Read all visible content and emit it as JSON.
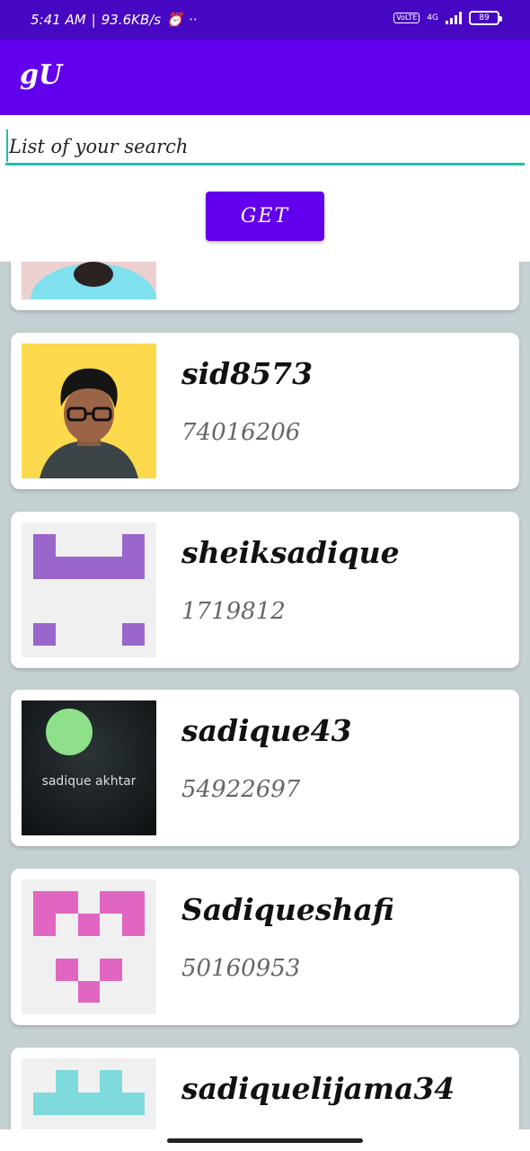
{
  "status_bar": {
    "time": "5:41 AM",
    "separator": "|",
    "speed": "93.6KB/s",
    "volte": "VoLTE",
    "network": "4G",
    "battery": "89"
  },
  "app_bar": {
    "title": "gU"
  },
  "search": {
    "placeholder": "List of your search",
    "value": ""
  },
  "get_button": {
    "label": "GET"
  },
  "results": [
    {
      "name": "",
      "id": ""
    },
    {
      "name": "sid8573",
      "id": "74016206"
    },
    {
      "name": "sheiksadique",
      "id": "1719812"
    },
    {
      "name": "sadique43",
      "id": "54922697",
      "avatar_caption": "sadique akhtar"
    },
    {
      "name": "Sadiqueshafi",
      "id": "50160953"
    },
    {
      "name": "sadiquelijama34",
      "id": ""
    }
  ],
  "colors": {
    "primary": "#6200ee",
    "status_bar": "#4608c2",
    "accent": "#1fbfb0",
    "background": "#c5d0d3"
  }
}
